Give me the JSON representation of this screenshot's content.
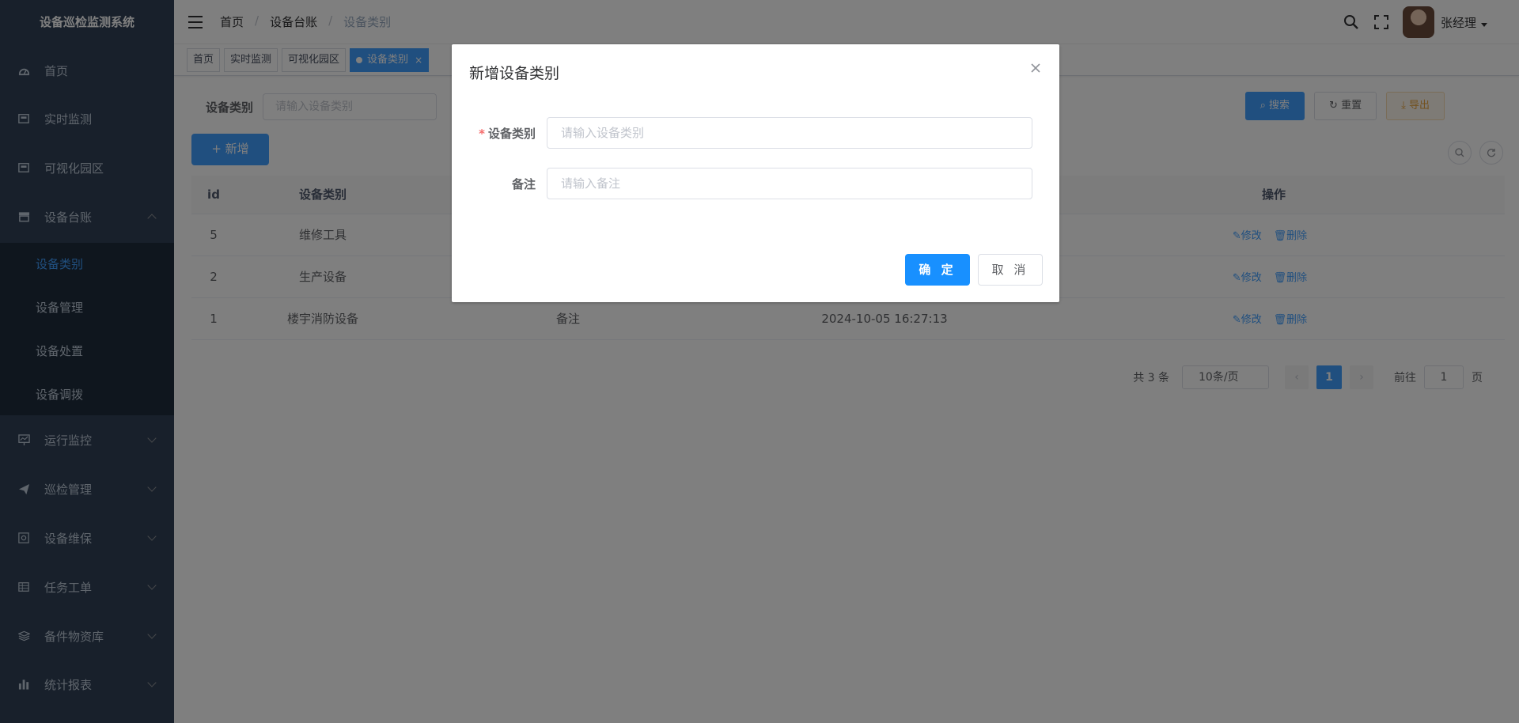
{
  "app": {
    "title": "设备巡检监测系统"
  },
  "sidebar": {
    "items": [
      {
        "label": "首页",
        "icon": "dashboard-icon"
      },
      {
        "label": "实时监测",
        "icon": "monitor-icon"
      },
      {
        "label": "可视化园区",
        "icon": "monitor-icon"
      },
      {
        "label": "设备台账",
        "icon": "archive-icon",
        "expanded": true
      },
      {
        "label": "运行监控",
        "icon": "chart-screen-icon"
      },
      {
        "label": "巡检管理",
        "icon": "send-icon"
      },
      {
        "label": "设备维保",
        "icon": "camera-icon"
      },
      {
        "label": "任务工单",
        "icon": "table-icon"
      },
      {
        "label": "备件物资库",
        "icon": "layers-icon"
      },
      {
        "label": "统计报表",
        "icon": "bar-chart-icon"
      }
    ],
    "submenu": [
      {
        "label": "设备类别",
        "active": true
      },
      {
        "label": "设备管理"
      },
      {
        "label": "设备处置"
      },
      {
        "label": "设备调拨"
      }
    ]
  },
  "navbar": {
    "breadcrumb": [
      "首页",
      "设备台账",
      "设备类别"
    ],
    "username": "张经理"
  },
  "tags": [
    "首页",
    "实时监测",
    "可视化园区",
    "设备类别"
  ],
  "search": {
    "label": "设备类别",
    "placeholder": "请输入设备类别",
    "search_btn": "搜索",
    "reset_btn": "重置",
    "export_btn": "导出"
  },
  "toolbar": {
    "add_btn": "新增"
  },
  "table": {
    "columns": [
      "id",
      "设备类别",
      "",
      "",
      "操作"
    ],
    "rows": [
      {
        "id": "5",
        "category": "维修工具",
        "remark": "",
        "time": ""
      },
      {
        "id": "2",
        "category": "生产设备",
        "remark": "",
        "time": ""
      },
      {
        "id": "1",
        "category": "楼宇消防设备",
        "remark": "备注",
        "time": "2024-10-05 16:27:13"
      }
    ],
    "edit_label": "修改",
    "delete_label": "删除"
  },
  "pagination": {
    "total_text": "共 3 条",
    "page_size": "10条/页",
    "current_page": "1",
    "goto_prefix": "前往",
    "goto_value": "1",
    "goto_suffix": "页"
  },
  "modal": {
    "title": "新增设备类别",
    "field_category_label": "设备类别",
    "field_category_placeholder": "请输入设备类别",
    "field_remark_label": "备注",
    "field_remark_placeholder": "请输入备注",
    "confirm": "确 定",
    "cancel": "取 消"
  },
  "colors": {
    "sidebar_bg": "#304156",
    "primary": "#409eff",
    "confirm_btn": "#1890ff",
    "required": "#f56c6c"
  }
}
